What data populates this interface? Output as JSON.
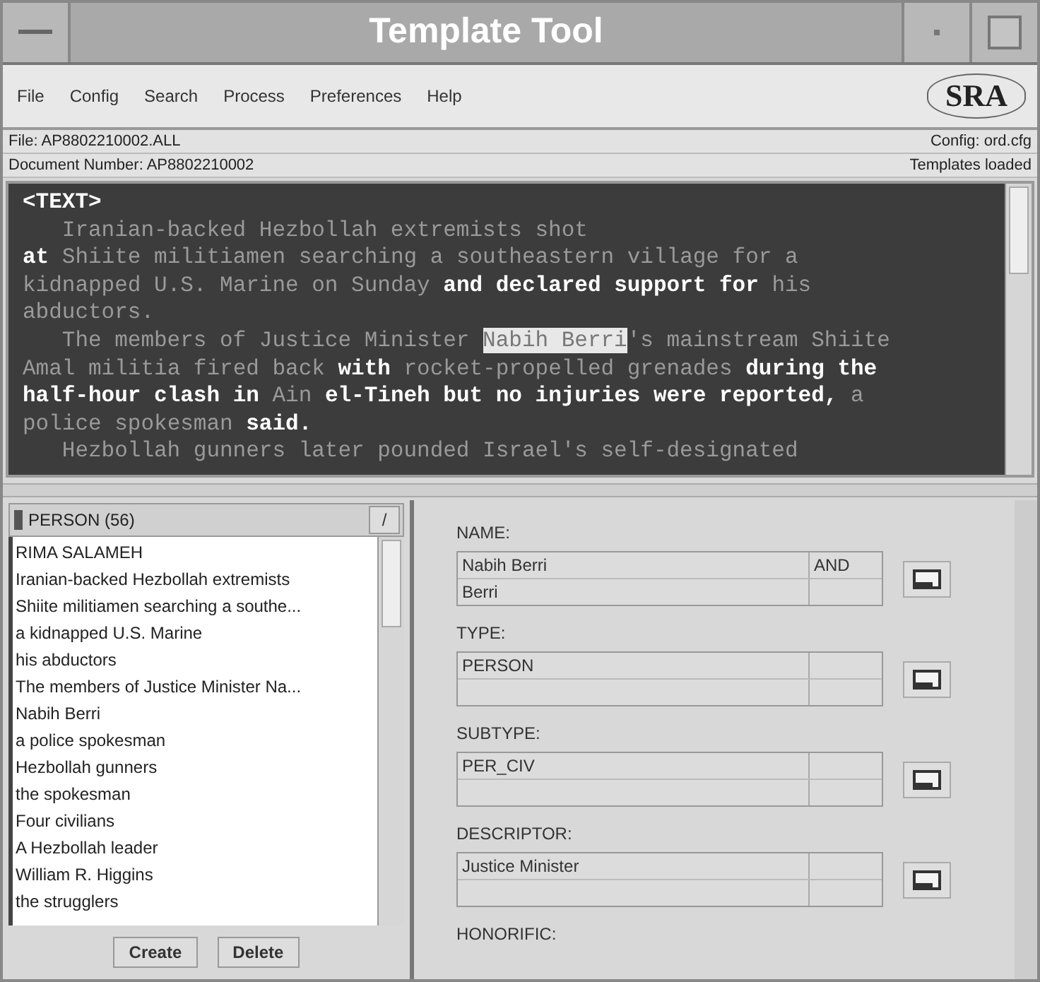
{
  "window": {
    "title": "Template Tool"
  },
  "menu": [
    "File",
    "Config",
    "Search",
    "Process",
    "Preferences",
    "Help"
  ],
  "logo": {
    "text": "SRA"
  },
  "info": [
    {
      "left": "File: AP8802210002.ALL",
      "right": "Config: ord.cfg"
    },
    {
      "left": "Document Number: AP8802210002",
      "right": "Templates loaded"
    }
  ],
  "document": {
    "lines": [
      {
        "indented": false,
        "segments": [
          {
            "text": "<TEXT>",
            "dim": false,
            "highlighted": false
          }
        ]
      },
      {
        "indented": true,
        "segments": [
          {
            "text": "Iranian-backed Hezbollah extremists shot",
            "dim": true,
            "highlighted": false
          }
        ]
      },
      {
        "indented": false,
        "segments": [
          {
            "text": "at",
            "dim": false,
            "highlighted": false
          },
          {
            "text": " Shiite militiamen searching a southeastern village for a",
            "dim": true,
            "highlighted": false
          }
        ]
      },
      {
        "indented": false,
        "segments": [
          {
            "text": "kidnapped U.S. Marine on Sunday",
            "dim": true,
            "highlighted": false
          },
          {
            "text": " and declared support for ",
            "dim": false,
            "highlighted": false
          },
          {
            "text": "his",
            "dim": true,
            "highlighted": false
          }
        ]
      },
      {
        "indented": false,
        "segments": [
          {
            "text": "abductors.",
            "dim": true,
            "highlighted": false
          }
        ]
      },
      {
        "indented": true,
        "segments": [
          {
            "text": "The members of Justice Minister ",
            "dim": true,
            "highlighted": false
          },
          {
            "text": "Nabih Berri",
            "dim": true,
            "highlighted": true
          },
          {
            "text": "'s mainstream Shiite",
            "dim": true,
            "highlighted": false
          }
        ]
      },
      {
        "indented": false,
        "segments": [
          {
            "text": "Amal militia fired back",
            "dim": true,
            "highlighted": false
          },
          {
            "text": " with ",
            "dim": false,
            "highlighted": false
          },
          {
            "text": "rocket-propelled grenades",
            "dim": true,
            "highlighted": false
          },
          {
            "text": " during the",
            "dim": false,
            "highlighted": false
          }
        ]
      },
      {
        "indented": false,
        "segments": [
          {
            "text": "half-hour clash in ",
            "dim": false,
            "highlighted": false
          },
          {
            "text": "Ain",
            "dim": true,
            "highlighted": false
          },
          {
            "text": " el-Tineh but no injuries were reported, ",
            "dim": false,
            "highlighted": false
          },
          {
            "text": "a",
            "dim": true,
            "highlighted": false
          }
        ]
      },
      {
        "indented": false,
        "segments": [
          {
            "text": "police spokesman",
            "dim": true,
            "highlighted": false
          },
          {
            "text": " said.",
            "dim": false,
            "highlighted": false
          }
        ]
      },
      {
        "indented": true,
        "segments": [
          {
            "text": "Hezbollah gunners later pounded Israel's self-designated",
            "dim": true,
            "highlighted": false
          }
        ]
      }
    ]
  },
  "entity_list": {
    "header": "PERSON (56)",
    "dropdown": "/",
    "items": [
      "RIMA SALAMEH",
      "Iranian-backed Hezbollah extremists",
      "Shiite militiamen searching a southe...",
      "a kidnapped U.S. Marine",
      "his abductors",
      "The members of Justice Minister Na...",
      "Nabih Berri",
      "a police spokesman",
      "Hezbollah gunners",
      "the spokesman",
      "Four civilians",
      "A Hezbollah leader",
      "William R. Higgins",
      "the strugglers"
    ],
    "buttons": [
      "Create",
      "Delete"
    ]
  },
  "slots": [
    {
      "label": "NAME:",
      "rows": [
        {
          "value": "Nabih Berri",
          "connector": "AND"
        },
        {
          "value": "Berri"
        }
      ]
    },
    {
      "label": "TYPE:",
      "rows": [
        {
          "value": "PERSON"
        }
      ]
    },
    {
      "label": "SUBTYPE:",
      "rows": [
        {
          "value": "PER_CIV"
        }
      ]
    },
    {
      "label": "DESCRIPTOR:",
      "rows": [
        {
          "value": "Justice Minister"
        }
      ]
    },
    {
      "label": "HONORIFIC:"
    }
  ]
}
